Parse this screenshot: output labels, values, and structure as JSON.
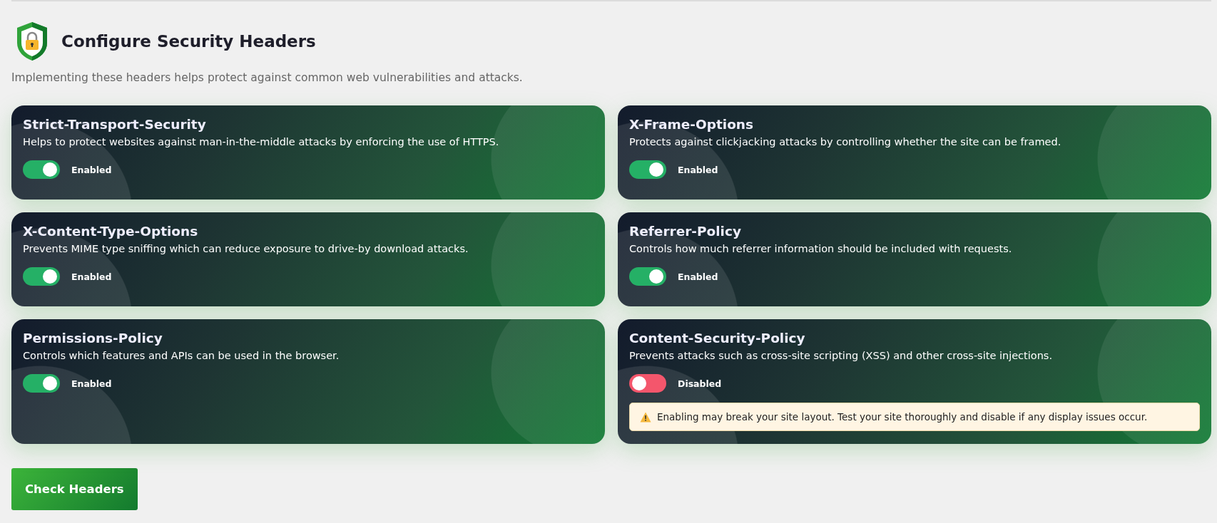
{
  "title": "Configure Security Headers",
  "subtitle": "Implementing these headers helps protect against common web vulnerabilities and attacks.",
  "headers": [
    {
      "name": "Strict-Transport-Security",
      "description": "Helps to protect websites against man-in-the-middle attacks by enforcing the use of HTTPS.",
      "enabled": true,
      "status": "Enabled"
    },
    {
      "name": "X-Frame-Options",
      "description": "Protects against clickjacking attacks by controlling whether the site can be framed.",
      "enabled": true,
      "status": "Enabled"
    },
    {
      "name": "X-Content-Type-Options",
      "description": "Prevents MIME type sniffing which can reduce exposure to drive-by download attacks.",
      "enabled": true,
      "status": "Enabled"
    },
    {
      "name": "Referrer-Policy",
      "description": "Controls how much referrer information should be included with requests.",
      "enabled": true,
      "status": "Enabled"
    },
    {
      "name": "Permissions-Policy",
      "description": "Controls which features and APIs can be used in the browser.",
      "enabled": true,
      "status": "Enabled"
    },
    {
      "name": "Content-Security-Policy",
      "description": "Prevents attacks such as cross-site scripting (XSS) and other cross-site injections.",
      "enabled": false,
      "status": "Disabled",
      "warning": "Enabling may break your site layout. Test your site thoroughly and disable if any display issues occur."
    }
  ],
  "button": "Check Headers"
}
